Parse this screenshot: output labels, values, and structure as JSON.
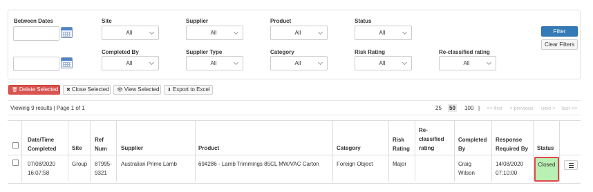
{
  "filters": {
    "between_dates": {
      "label": "Between Dates",
      "from_value": "",
      "to_value": ""
    },
    "site": {
      "label": "Site",
      "value": "All"
    },
    "supplier": {
      "label": "Supplier",
      "value": "All"
    },
    "product": {
      "label": "Product",
      "value": "All"
    },
    "status": {
      "label": "Status",
      "value": "All"
    },
    "completed_by": {
      "label": "Completed By",
      "value": "All"
    },
    "supplier_type": {
      "label": "Supplier Type",
      "value": "All"
    },
    "category": {
      "label": "Category",
      "value": "All"
    },
    "risk_rating": {
      "label": "Risk Rating",
      "value": "All"
    },
    "reclassified_rating": {
      "label": "Re-classified rating",
      "value": "All"
    },
    "filter_button": "Filter",
    "clear_button": "Clear Filters"
  },
  "actions": {
    "delete_selected": "Delete Selected",
    "close_selected": "Close Selected",
    "view_selected": "View Selected",
    "export_excel": "Export to Excel"
  },
  "pager": {
    "viewing": "Viewing 9 results | Page 1 of 1",
    "sizes": [
      "25",
      "50",
      "100"
    ],
    "active_size": "50",
    "separator": "|",
    "first": "<< first",
    "previous": "< previous",
    "next": "next >",
    "last": "last >>"
  },
  "table": {
    "headers": {
      "date_time": [
        "Date/Time",
        "Completed"
      ],
      "site": [
        "Site"
      ],
      "ref_num": [
        "Ref",
        "Num"
      ],
      "supplier": [
        "Supplier"
      ],
      "product": [
        "Product"
      ],
      "category": [
        "Category"
      ],
      "risk_rating": [
        "Risk",
        "Rating"
      ],
      "reclassified": [
        "Re-",
        "classified",
        "rating"
      ],
      "completed_by": [
        "Completed",
        "By"
      ],
      "response_required": [
        "Response",
        "Required By"
      ],
      "status": [
        "Status"
      ]
    },
    "rows": [
      {
        "date_time": [
          "07/08/2020",
          "16:07:58"
        ],
        "site": "Group",
        "ref_num": [
          "87995-",
          "9321"
        ],
        "supplier": "Australian Prime Lamb",
        "product": "694286 - Lamb Trimmings 85CL MW/VAC Carton",
        "category": "Foreign Object",
        "risk_rating": "Major",
        "reclassified": "",
        "completed_by": [
          "Craig",
          "Wilson"
        ],
        "response_required": [
          "14/08/2020",
          "07:10:00"
        ],
        "status": "Closed",
        "status_color": "#b9f0b3",
        "highlight_color": "#e0474c"
      }
    ]
  },
  "icons": {
    "calendar": "calendar-icon",
    "trash": "trash-icon",
    "close": "close-icon",
    "eye": "eye-icon",
    "download": "download-icon",
    "list": "list-icon"
  },
  "colors": {
    "primary": "#337ab7",
    "danger": "#d9534f",
    "status_closed": "#b9f0b3"
  }
}
